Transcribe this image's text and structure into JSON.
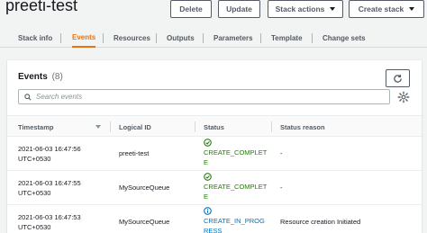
{
  "header": {
    "stack_name": "preeti-test",
    "buttons": {
      "delete": "Delete",
      "update": "Update",
      "stack_actions": "Stack actions",
      "create_stack": "Create stack"
    }
  },
  "tabs": [
    {
      "label": "Stack info",
      "active": false
    },
    {
      "label": "Events",
      "active": true
    },
    {
      "label": "Resources",
      "active": false
    },
    {
      "label": "Outputs",
      "active": false
    },
    {
      "label": "Parameters",
      "active": false
    },
    {
      "label": "Template",
      "active": false
    },
    {
      "label": "Change sets",
      "active": false
    }
  ],
  "events": {
    "title": "Events",
    "count": "(8)",
    "search_placeholder": "Search events",
    "columns": [
      "Timestamp",
      "Logical ID",
      "Status",
      "Status reason"
    ],
    "rows": [
      {
        "timestamp": "2021-06-03 16:47:56 UTC+0530",
        "logical_id": "preeti-test",
        "status": "CREATE_COMPLETE",
        "status_icon": "check-circle-icon",
        "reason": "-"
      },
      {
        "timestamp": "2021-06-03 16:47:55 UTC+0530",
        "logical_id": "MySourceQueue",
        "status": "CREATE_COMPLETE",
        "status_icon": "check-circle-icon",
        "reason": "-"
      },
      {
        "timestamp": "2021-06-03 16:47:53 UTC+0530",
        "logical_id": "MySourceQueue",
        "status": "CREATE_IN_PROGRESS",
        "status_icon": "info-circle-icon",
        "reason": "Resource creation Initiated"
      }
    ]
  },
  "colors": {
    "accent": "#ec7211",
    "success": "#1d8102",
    "info": "#0073bb"
  }
}
